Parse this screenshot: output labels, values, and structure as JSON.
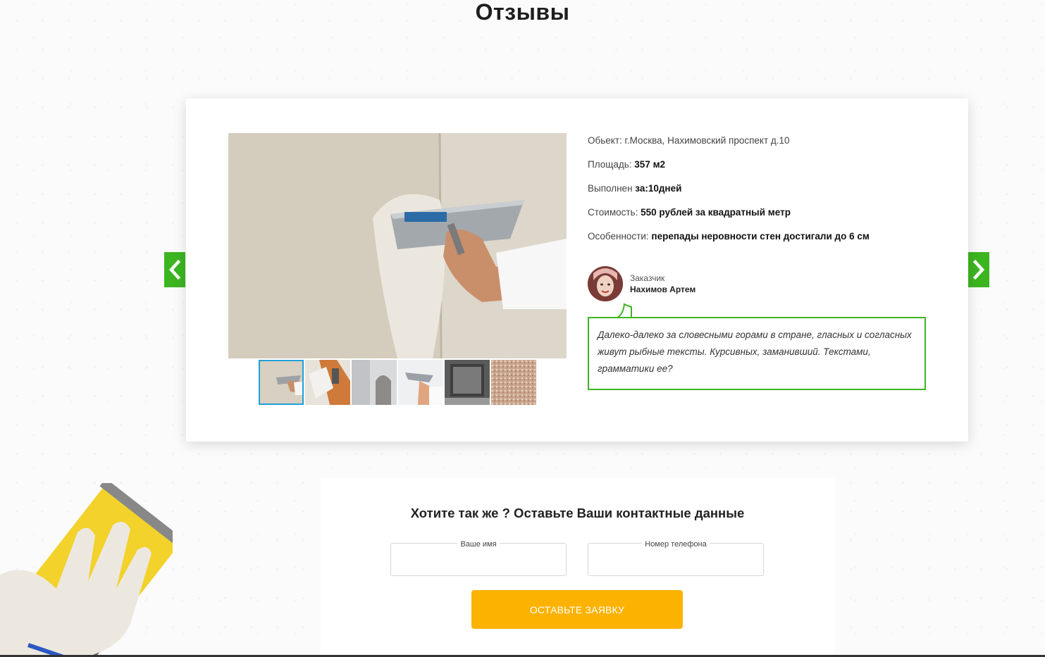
{
  "section": {
    "title": "Отзывы"
  },
  "review": {
    "object_label": "Обьект:",
    "object_value": "г.Москва, Нахимовский проспект д.10",
    "area_label": "Площадь:",
    "area_value": "357 м2",
    "done_label": "Выполнен",
    "done_value": "за:10дней",
    "cost_label": "Стоимость:",
    "cost_value": "550 рублей за квадратный метр",
    "features_label": "Особенности:",
    "features_value": "перепады неровности стен достигали до 6 см",
    "customer_label": "Заказчик",
    "customer_name": "Нахимов Артем",
    "text": "Далеко-далеко за словесными горами в стране, гласных и согласных живут рыбные тексты. Курсивных, заманивший. Текстами, грамматики ее?",
    "thumbnail_count": 6,
    "active_thumbnail": 1
  },
  "form": {
    "title": "Хотите так же ? Оставьте Ваши контактные данные",
    "name_label": "Ваше имя",
    "phone_label": "Номер телефона",
    "submit_label": "Оставьте заявку"
  },
  "icons": {
    "prev": "chevron-left-icon",
    "next": "chevron-right-icon"
  },
  "colors": {
    "accent_green": "#3cb521",
    "button_yellow": "#fcb200",
    "thumb_active": "#1ea0d6"
  }
}
